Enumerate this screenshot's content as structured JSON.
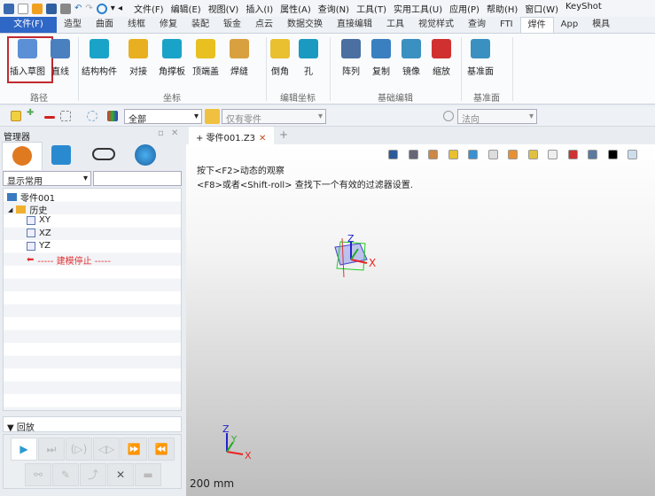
{
  "menubar": {
    "items": [
      "文件(F)",
      "编辑(E)",
      "视图(V)",
      "插入(I)",
      "属性(A)",
      "查询(N)",
      "工具(T)",
      "实用工具(U)",
      "应用(P)",
      "帮助(H)",
      "窗口(W)",
      "KeyShot"
    ]
  },
  "ribbon_tabs": [
    "文件(F)",
    "造型",
    "曲面",
    "线框",
    "修复",
    "装配",
    "钣金",
    "点云",
    "数据交换",
    "直接编辑",
    "工具",
    "视觉样式",
    "查询",
    "FTI",
    "焊件",
    "App",
    "模具"
  ],
  "active_tab": "焊件",
  "ribbon": {
    "buttons": [
      {
        "label": "插入草图",
        "color": "#5b8fd6"
      },
      {
        "label": "直线",
        "color": "#4a7fc0"
      },
      {
        "label": "结构构件",
        "color": "#1aa3c8"
      },
      {
        "label": "对接",
        "color": "#e8b020"
      },
      {
        "label": "角撑板",
        "color": "#1aa3c8"
      },
      {
        "label": "顶端盖",
        "color": "#e8c020"
      },
      {
        "label": "焊缝",
        "color": "#d9a040"
      },
      {
        "label": "倒角",
        "color": "#e8c030"
      },
      {
        "label": "孔",
        "color": "#1a9ac0"
      },
      {
        "label": "阵列",
        "color": "#4a6fa0"
      },
      {
        "label": "复制",
        "color": "#3a80c0"
      },
      {
        "label": "镜像",
        "color": "#3a90c0"
      },
      {
        "label": "缩放",
        "color": "#d03030"
      },
      {
        "label": "基准面",
        "color": "#3a90c0"
      }
    ],
    "groups": [
      "路径",
      "坐标",
      "编辑坐标",
      "基础编辑",
      "基准面"
    ]
  },
  "toolbar": {
    "filter_value": "全部",
    "filter2_value": "仅有零件",
    "direction_value": "法向"
  },
  "manager": {
    "title": "管理器",
    "display_select": "显示常用"
  },
  "tree": {
    "root": "零件001",
    "history": "历史",
    "planes": [
      "XY",
      "XZ",
      "YZ"
    ],
    "stop": "----- 建模停止 -----"
  },
  "replay": {
    "title": "回放"
  },
  "doc_tab": {
    "label": "零件001.Z3"
  },
  "viewport": {
    "hint1": "按下<F2>动态的观察",
    "hint2": "<F8>或者<Shift-roll> 查找下一个有效的过滤器设置.",
    "scale": "200 mm",
    "axis_x": "X",
    "axis_y": "Y",
    "axis_z": "Z"
  }
}
